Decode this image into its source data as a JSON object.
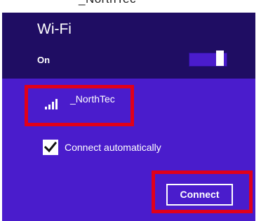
{
  "header_text": "_NorthTec",
  "panel": {
    "title": "Wi-Fi",
    "state_label": "On",
    "toggle_on": true,
    "background_top": "#1f0d63",
    "background_bottom": "#4a1ccc"
  },
  "network": {
    "name": "_NorthTec",
    "signal_icon": "wifi-signal-icon",
    "signal_bars": 4
  },
  "auto_connect": {
    "label": "Connect automatically",
    "checked": true
  },
  "connect_button": {
    "label": "Connect"
  },
  "highlight_color": "#e1001a"
}
